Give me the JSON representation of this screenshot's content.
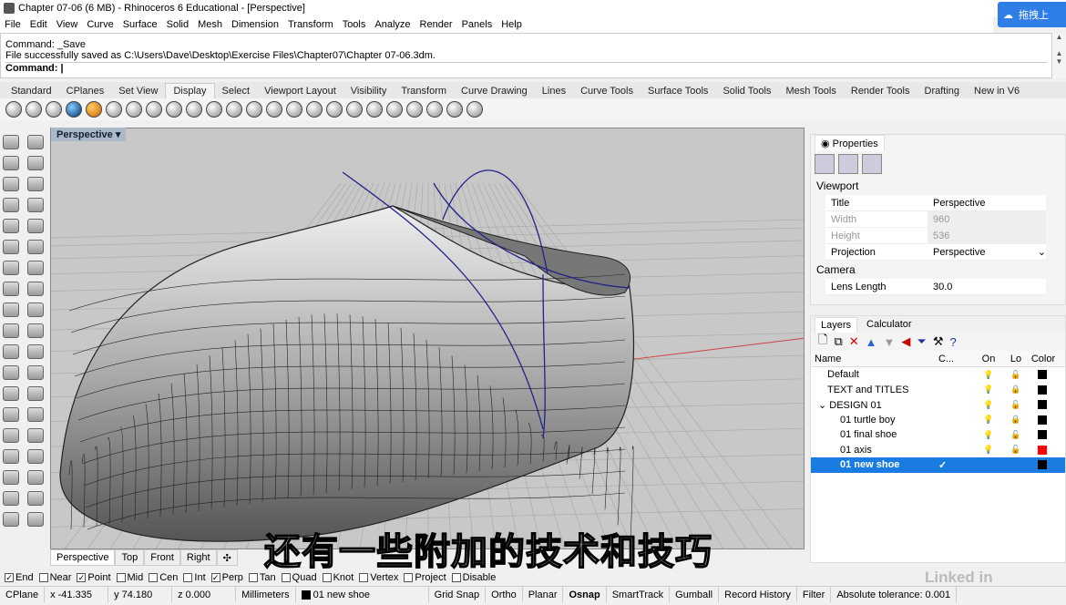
{
  "window": {
    "title": "Chapter 07-06 (6 MB) - Rhinoceros 6 Educational - [Perspective]",
    "cloud_button": "拖拽上"
  },
  "menu": [
    "File",
    "Edit",
    "View",
    "Curve",
    "Surface",
    "Solid",
    "Mesh",
    "Dimension",
    "Transform",
    "Tools",
    "Analyze",
    "Render",
    "Panels",
    "Help"
  ],
  "command": {
    "history": [
      "Command: _Save",
      "File successfully saved as C:\\Users\\Dave\\Desktop\\Exercise Files\\Chapter07\\Chapter 07-06.3dm."
    ],
    "prompt": "Command:"
  },
  "toolbar_tabs": [
    "Standard",
    "CPlanes",
    "Set View",
    "Display",
    "Select",
    "Viewport Layout",
    "Visibility",
    "Transform",
    "Curve Drawing",
    "Lines",
    "Curve Tools",
    "Surface Tools",
    "Solid Tools",
    "Mesh Tools",
    "Render Tools",
    "Drafting",
    "New in V6"
  ],
  "active_tab": "Display",
  "viewport": {
    "label": "Perspective",
    "tabs": [
      "Perspective",
      "Top",
      "Front",
      "Right"
    ]
  },
  "subtitle": "还有一些附加的技术和技巧",
  "watermark": "Linked in LEARNING",
  "osnap": [
    {
      "label": "End",
      "checked": true
    },
    {
      "label": "Near",
      "checked": false
    },
    {
      "label": "Point",
      "checked": true
    },
    {
      "label": "Mid",
      "checked": false
    },
    {
      "label": "Cen",
      "checked": false
    },
    {
      "label": "Int",
      "checked": false
    },
    {
      "label": "Perp",
      "checked": true
    },
    {
      "label": "Tan",
      "checked": false
    },
    {
      "label": "Quad",
      "checked": false
    },
    {
      "label": "Knot",
      "checked": false
    },
    {
      "label": "Vertex",
      "checked": false
    },
    {
      "label": "Project",
      "checked": false
    },
    {
      "label": "Disable",
      "checked": false
    }
  ],
  "status": {
    "cplane": "CPlane",
    "x": "x -41.335",
    "y": "y 74.180",
    "z": "z 0.000",
    "units": "Millimeters",
    "layer": "01 new shoe",
    "toggles": [
      "Grid Snap",
      "Ortho",
      "Planar",
      "Osnap",
      "SmartTrack",
      "Gumball",
      "Record History",
      "Filter"
    ],
    "bold_toggle": "Osnap",
    "tolerance": "Absolute tolerance: 0.001"
  },
  "properties": {
    "tab": "Properties",
    "section1": "Viewport",
    "rows": [
      {
        "k": "Title",
        "v": "Perspective"
      },
      {
        "k": "Width",
        "v": "960"
      },
      {
        "k": "Height",
        "v": "536"
      },
      {
        "k": "Projection",
        "v": "Perspective"
      }
    ],
    "section2": "Camera",
    "lens": {
      "k": "Lens Length",
      "v": "30.0"
    }
  },
  "layers": {
    "tabs": [
      "Layers",
      "Calculator"
    ],
    "columns": [
      "Name",
      "C...",
      "On",
      "Lo",
      "Color"
    ],
    "rows": [
      {
        "name": "Default",
        "indent": 0,
        "color": "#000000",
        "locked": false
      },
      {
        "name": "TEXT and TITLES",
        "indent": 0,
        "color": "#000000",
        "locked": true
      },
      {
        "name": "DESIGN 01",
        "indent": 0,
        "color": "#000000",
        "locked": false,
        "expanded": true
      },
      {
        "name": "01 turtle boy",
        "indent": 1,
        "color": "#000000",
        "locked": true
      },
      {
        "name": "01 final shoe",
        "indent": 1,
        "color": "#000000",
        "locked": false
      },
      {
        "name": "01 axis",
        "indent": 1,
        "color": "#ff0000",
        "locked": false
      },
      {
        "name": "01 new shoe",
        "indent": 1,
        "color": "#000000",
        "current": true
      }
    ]
  }
}
